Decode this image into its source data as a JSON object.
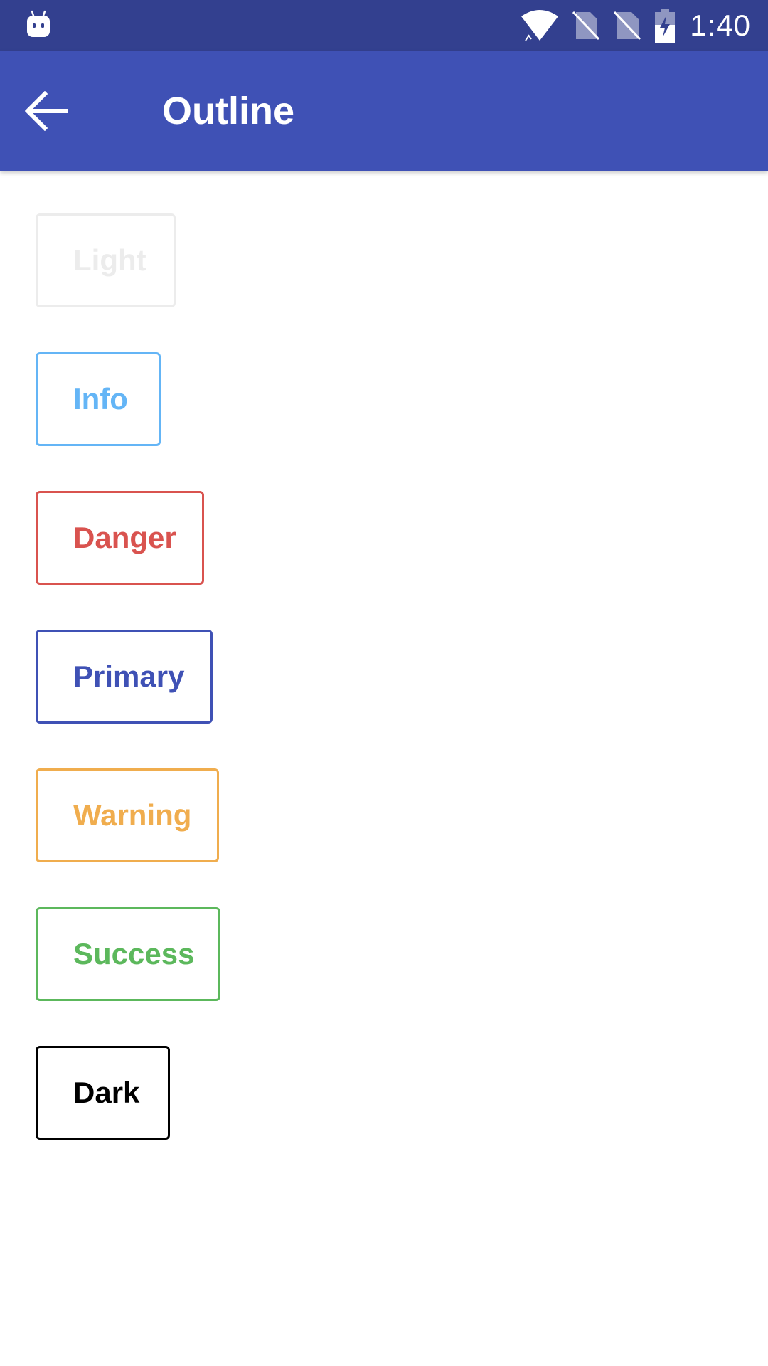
{
  "status_bar": {
    "time": "1:40",
    "icons": [
      "android-icon",
      "wifi-icon",
      "no-sim-icon",
      "no-sim-icon",
      "battery-charging-icon"
    ]
  },
  "app_bar": {
    "title": "Outline",
    "back_icon": "arrow-left-icon"
  },
  "buttons": [
    {
      "label": "Light",
      "color": "#ececec"
    },
    {
      "label": "Info",
      "color": "#64b5f6"
    },
    {
      "label": "Danger",
      "color": "#d9534f"
    },
    {
      "label": "Primary",
      "color": "#3f51b5"
    },
    {
      "label": "Warning",
      "color": "#f0ad4e"
    },
    {
      "label": "Success",
      "color": "#5cb85c"
    },
    {
      "label": "Dark",
      "color": "#000000"
    }
  ],
  "colors": {
    "status_bar": "#33408f",
    "app_bar": "#3f51b5",
    "background": "#ffffff"
  }
}
